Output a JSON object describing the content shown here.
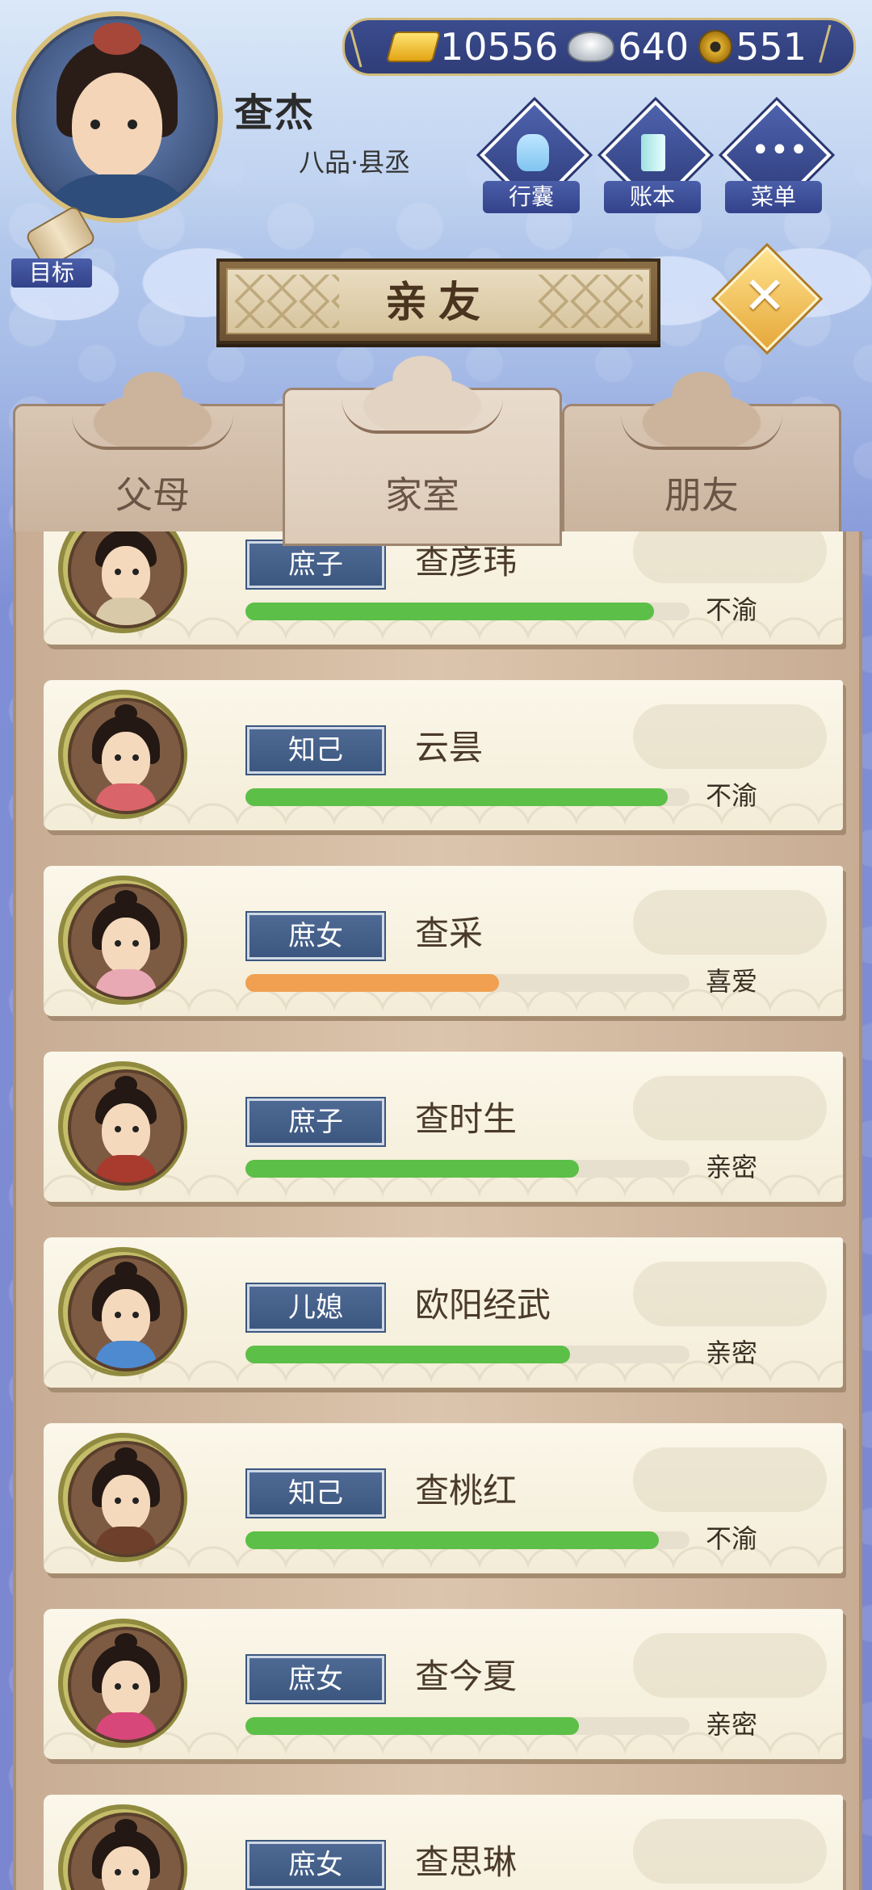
{
  "player": {
    "name": "查杰",
    "rank": "八品·县丞"
  },
  "currency": {
    "gold": "10556",
    "silver": "640",
    "coins": "551"
  },
  "menu_buttons": {
    "bag": "行囊",
    "ledger": "账本",
    "menu": "菜单",
    "goal": "目标"
  },
  "title": "亲友",
  "tabs": [
    {
      "label": "父母"
    },
    {
      "label": "家室"
    },
    {
      "label": "朋友"
    }
  ],
  "active_tab": "家室",
  "members": [
    {
      "role": "庶子",
      "name": "查彦玮",
      "status": "不渝",
      "affection": 0.92,
      "bar_color": "#5cbf47",
      "gender": "m",
      "robe": "#d8c9a8"
    },
    {
      "role": "知己",
      "name": "云昙",
      "status": "不渝",
      "affection": 0.95,
      "bar_color": "#5cbf47",
      "gender": "f",
      "robe": "#d9646a"
    },
    {
      "role": "庶女",
      "name": "查采",
      "status": "喜爱",
      "affection": 0.57,
      "bar_color": "#f0a050",
      "gender": "f",
      "robe": "#e9a9b4"
    },
    {
      "role": "庶子",
      "name": "查时生",
      "status": "亲密",
      "affection": 0.75,
      "bar_color": "#5cbf47",
      "gender": "m",
      "robe": "#a83a2e"
    },
    {
      "role": "儿媳",
      "name": "欧阳经武",
      "status": "亲密",
      "affection": 0.73,
      "bar_color": "#5cbf47",
      "gender": "f",
      "robe": "#4e8ad0"
    },
    {
      "role": "知己",
      "name": "查桃红",
      "status": "不渝",
      "affection": 0.93,
      "bar_color": "#5cbf47",
      "gender": "f",
      "robe": "#6e3f2a"
    },
    {
      "role": "庶女",
      "name": "查今夏",
      "status": "亲密",
      "affection": 0.75,
      "bar_color": "#5cbf47",
      "gender": "f",
      "robe": "#d7477a"
    },
    {
      "role": "庶女",
      "name": "查思琳",
      "status": "",
      "affection": 0,
      "bar_color": "#5cbf47",
      "gender": "f",
      "robe": "#c0a060"
    }
  ]
}
